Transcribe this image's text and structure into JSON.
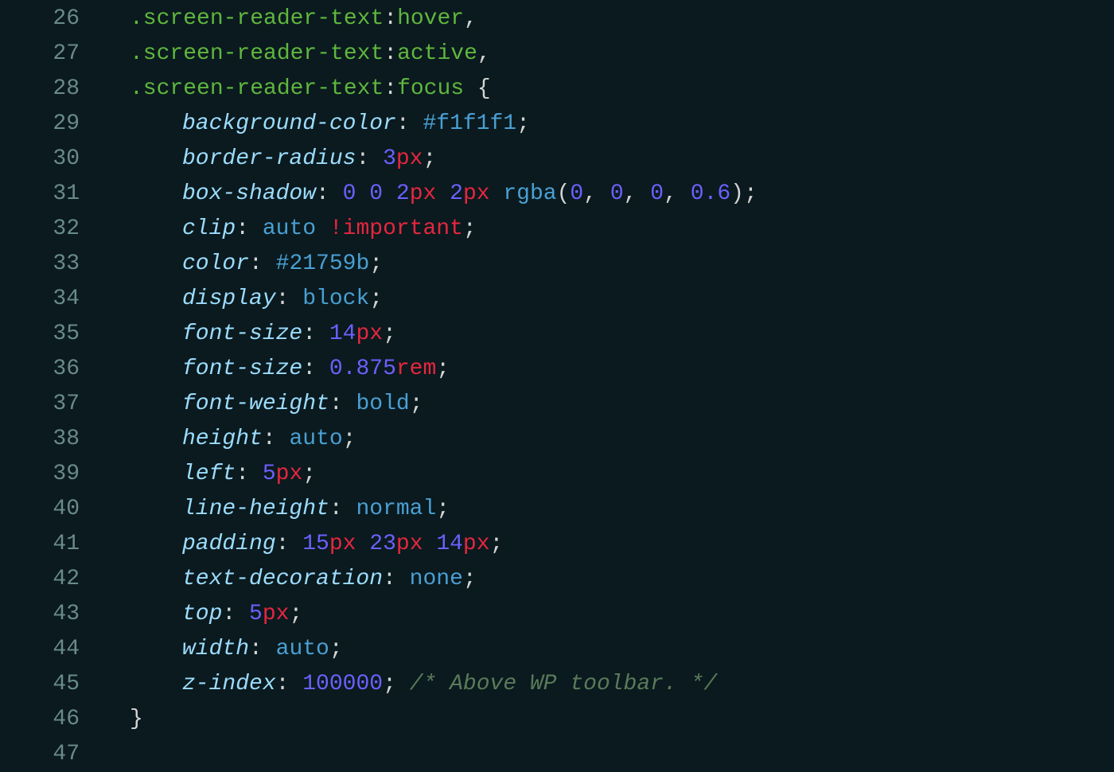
{
  "editor": {
    "startLine": 26,
    "lines": [
      {
        "num": 26,
        "indent": 1,
        "tokens": [
          {
            "t": "selector",
            "v": ".screen-reader-text"
          },
          {
            "t": "colon",
            "v": ":"
          },
          {
            "t": "pseudo",
            "v": "hover"
          },
          {
            "t": "comma",
            "v": ","
          }
        ]
      },
      {
        "num": 27,
        "indent": 1,
        "tokens": [
          {
            "t": "selector",
            "v": ".screen-reader-text"
          },
          {
            "t": "colon",
            "v": ":"
          },
          {
            "t": "pseudo",
            "v": "active"
          },
          {
            "t": "comma",
            "v": ","
          }
        ]
      },
      {
        "num": 28,
        "indent": 1,
        "tokens": [
          {
            "t": "selector",
            "v": ".screen-reader-text"
          },
          {
            "t": "colon",
            "v": ":"
          },
          {
            "t": "pseudo",
            "v": "focus"
          },
          {
            "t": "plain",
            "v": " "
          },
          {
            "t": "brace",
            "v": "{"
          }
        ]
      },
      {
        "num": 29,
        "indent": 2,
        "tokens": [
          {
            "t": "property",
            "v": "background-color"
          },
          {
            "t": "colon",
            "v": ":"
          },
          {
            "t": "plain",
            "v": " "
          },
          {
            "t": "value-hex",
            "v": "#f1f1f1"
          },
          {
            "t": "semicolon",
            "v": ";"
          }
        ]
      },
      {
        "num": 30,
        "indent": 2,
        "tokens": [
          {
            "t": "property",
            "v": "border-radius"
          },
          {
            "t": "colon",
            "v": ":"
          },
          {
            "t": "plain",
            "v": " "
          },
          {
            "t": "value-number",
            "v": "3"
          },
          {
            "t": "value-unit",
            "v": "px"
          },
          {
            "t": "semicolon",
            "v": ";"
          }
        ]
      },
      {
        "num": 31,
        "indent": 2,
        "tokens": [
          {
            "t": "property",
            "v": "box-shadow"
          },
          {
            "t": "colon",
            "v": ":"
          },
          {
            "t": "plain",
            "v": " "
          },
          {
            "t": "value-number",
            "v": "0"
          },
          {
            "t": "plain",
            "v": " "
          },
          {
            "t": "value-number",
            "v": "0"
          },
          {
            "t": "plain",
            "v": " "
          },
          {
            "t": "value-number",
            "v": "2"
          },
          {
            "t": "value-unit",
            "v": "px"
          },
          {
            "t": "plain",
            "v": " "
          },
          {
            "t": "value-number",
            "v": "2"
          },
          {
            "t": "value-unit",
            "v": "px"
          },
          {
            "t": "plain",
            "v": " "
          },
          {
            "t": "value-func",
            "v": "rgba"
          },
          {
            "t": "paren",
            "v": "("
          },
          {
            "t": "value-number",
            "v": "0"
          },
          {
            "t": "comma",
            "v": ","
          },
          {
            "t": "plain",
            "v": " "
          },
          {
            "t": "value-number",
            "v": "0"
          },
          {
            "t": "comma",
            "v": ","
          },
          {
            "t": "plain",
            "v": " "
          },
          {
            "t": "value-number",
            "v": "0"
          },
          {
            "t": "comma",
            "v": ","
          },
          {
            "t": "plain",
            "v": " "
          },
          {
            "t": "value-number",
            "v": "0.6"
          },
          {
            "t": "paren",
            "v": ")"
          },
          {
            "t": "semicolon",
            "v": ";"
          }
        ]
      },
      {
        "num": 32,
        "indent": 2,
        "tokens": [
          {
            "t": "property",
            "v": "clip"
          },
          {
            "t": "colon",
            "v": ":"
          },
          {
            "t": "plain",
            "v": " "
          },
          {
            "t": "value-keyword",
            "v": "auto"
          },
          {
            "t": "plain",
            "v": " "
          },
          {
            "t": "value-important",
            "v": "!important"
          },
          {
            "t": "semicolon",
            "v": ";"
          }
        ]
      },
      {
        "num": 33,
        "indent": 2,
        "tokens": [
          {
            "t": "property",
            "v": "color"
          },
          {
            "t": "colon",
            "v": ":"
          },
          {
            "t": "plain",
            "v": " "
          },
          {
            "t": "value-hex",
            "v": "#21759b"
          },
          {
            "t": "semicolon",
            "v": ";"
          }
        ]
      },
      {
        "num": 34,
        "indent": 2,
        "tokens": [
          {
            "t": "property",
            "v": "display"
          },
          {
            "t": "colon",
            "v": ":"
          },
          {
            "t": "plain",
            "v": " "
          },
          {
            "t": "value-keyword",
            "v": "block"
          },
          {
            "t": "semicolon",
            "v": ";"
          }
        ]
      },
      {
        "num": 35,
        "indent": 2,
        "tokens": [
          {
            "t": "property",
            "v": "font-size"
          },
          {
            "t": "colon",
            "v": ":"
          },
          {
            "t": "plain",
            "v": " "
          },
          {
            "t": "value-number",
            "v": "14"
          },
          {
            "t": "value-unit",
            "v": "px"
          },
          {
            "t": "semicolon",
            "v": ";"
          }
        ]
      },
      {
        "num": 36,
        "indent": 2,
        "tokens": [
          {
            "t": "property",
            "v": "font-size"
          },
          {
            "t": "colon",
            "v": ":"
          },
          {
            "t": "plain",
            "v": " "
          },
          {
            "t": "value-number",
            "v": "0.875"
          },
          {
            "t": "value-unit",
            "v": "rem"
          },
          {
            "t": "semicolon",
            "v": ";"
          }
        ]
      },
      {
        "num": 37,
        "indent": 2,
        "tokens": [
          {
            "t": "property",
            "v": "font-weight"
          },
          {
            "t": "colon",
            "v": ":"
          },
          {
            "t": "plain",
            "v": " "
          },
          {
            "t": "value-keyword",
            "v": "bold"
          },
          {
            "t": "semicolon",
            "v": ";"
          }
        ]
      },
      {
        "num": 38,
        "indent": 2,
        "tokens": [
          {
            "t": "property",
            "v": "height"
          },
          {
            "t": "colon",
            "v": ":"
          },
          {
            "t": "plain",
            "v": " "
          },
          {
            "t": "value-keyword",
            "v": "auto"
          },
          {
            "t": "semicolon",
            "v": ";"
          }
        ]
      },
      {
        "num": 39,
        "indent": 2,
        "tokens": [
          {
            "t": "property",
            "v": "left"
          },
          {
            "t": "colon",
            "v": ":"
          },
          {
            "t": "plain",
            "v": " "
          },
          {
            "t": "value-number",
            "v": "5"
          },
          {
            "t": "value-unit",
            "v": "px"
          },
          {
            "t": "semicolon",
            "v": ";"
          }
        ]
      },
      {
        "num": 40,
        "indent": 2,
        "tokens": [
          {
            "t": "property",
            "v": "line-height"
          },
          {
            "t": "colon",
            "v": ":"
          },
          {
            "t": "plain",
            "v": " "
          },
          {
            "t": "value-keyword",
            "v": "normal"
          },
          {
            "t": "semicolon",
            "v": ";"
          }
        ]
      },
      {
        "num": 41,
        "indent": 2,
        "tokens": [
          {
            "t": "property",
            "v": "padding"
          },
          {
            "t": "colon",
            "v": ":"
          },
          {
            "t": "plain",
            "v": " "
          },
          {
            "t": "value-number",
            "v": "15"
          },
          {
            "t": "value-unit",
            "v": "px"
          },
          {
            "t": "plain",
            "v": " "
          },
          {
            "t": "value-number",
            "v": "23"
          },
          {
            "t": "value-unit",
            "v": "px"
          },
          {
            "t": "plain",
            "v": " "
          },
          {
            "t": "value-number",
            "v": "14"
          },
          {
            "t": "value-unit",
            "v": "px"
          },
          {
            "t": "semicolon",
            "v": ";"
          }
        ]
      },
      {
        "num": 42,
        "indent": 2,
        "tokens": [
          {
            "t": "property",
            "v": "text-decoration"
          },
          {
            "t": "colon",
            "v": ":"
          },
          {
            "t": "plain",
            "v": " "
          },
          {
            "t": "value-keyword",
            "v": "none"
          },
          {
            "t": "semicolon",
            "v": ";"
          }
        ]
      },
      {
        "num": 43,
        "indent": 2,
        "tokens": [
          {
            "t": "property",
            "v": "top"
          },
          {
            "t": "colon",
            "v": ":"
          },
          {
            "t": "plain",
            "v": " "
          },
          {
            "t": "value-number",
            "v": "5"
          },
          {
            "t": "value-unit",
            "v": "px"
          },
          {
            "t": "semicolon",
            "v": ";"
          }
        ]
      },
      {
        "num": 44,
        "indent": 2,
        "tokens": [
          {
            "t": "property",
            "v": "width"
          },
          {
            "t": "colon",
            "v": ":"
          },
          {
            "t": "plain",
            "v": " "
          },
          {
            "t": "value-keyword",
            "v": "auto"
          },
          {
            "t": "semicolon",
            "v": ";"
          }
        ]
      },
      {
        "num": 45,
        "indent": 2,
        "tokens": [
          {
            "t": "property",
            "v": "z-index"
          },
          {
            "t": "colon",
            "v": ":"
          },
          {
            "t": "plain",
            "v": " "
          },
          {
            "t": "value-number",
            "v": "100000"
          },
          {
            "t": "semicolon",
            "v": ";"
          },
          {
            "t": "plain",
            "v": " "
          },
          {
            "t": "comment",
            "v": "/* Above WP toolbar. */"
          }
        ]
      },
      {
        "num": 46,
        "indent": 1,
        "tokens": [
          {
            "t": "brace",
            "v": "}"
          }
        ]
      },
      {
        "num": 47,
        "indent": 0,
        "tokens": []
      }
    ]
  }
}
